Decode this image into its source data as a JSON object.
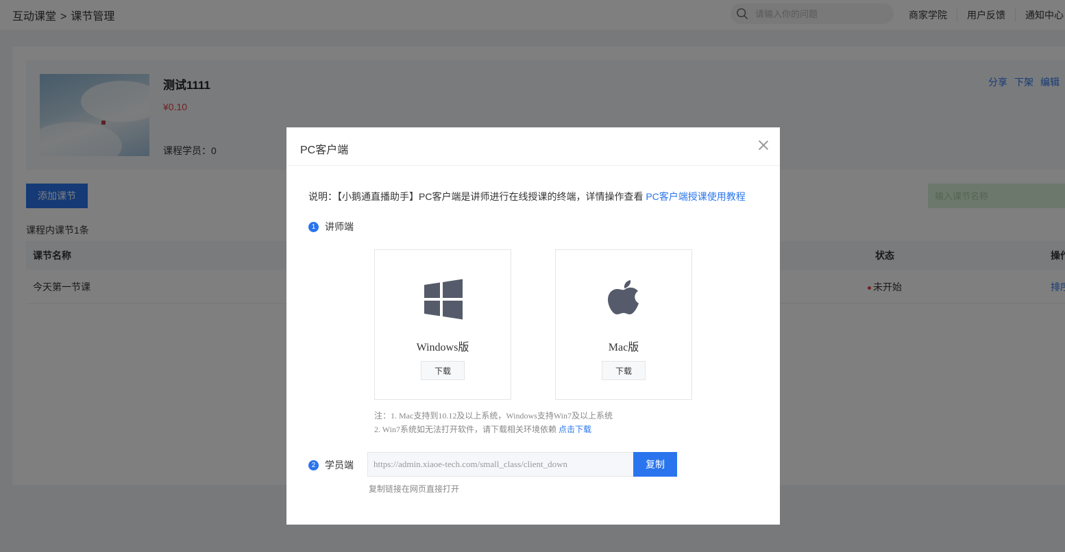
{
  "header": {
    "breadcrumb_home": "互动课堂",
    "breadcrumb_sep": ">",
    "breadcrumb_current": "课节管理",
    "search_placeholder": "请输入你的问题",
    "links": [
      "商家学院",
      "用户反馈",
      "通知中心"
    ]
  },
  "course": {
    "title": "测试1111",
    "price": "¥0.10",
    "students": "课程学员：0",
    "actions": [
      "分享",
      "下架",
      "编辑"
    ]
  },
  "lessons": {
    "add_button": "添加课节",
    "search_placeholder": "输入课节名称",
    "count_text": "课程内课节1条",
    "columns": {
      "name": "课节名称",
      "status": "状态",
      "ops": "操作"
    },
    "rows": [
      {
        "name": "今天第一节课",
        "status": "未开始",
        "op": "排序"
      }
    ]
  },
  "modal": {
    "title": "PC客户端",
    "desc_prefix": "说明：【小鹅通直播助手】PC客户端是讲师进行在线授课的终端，详情操作查看",
    "desc_link": "PC客户端授课使用教程",
    "step1_num": "1",
    "step1_label": "讲师端",
    "windows_label": "Windows版",
    "mac_label": "Mac版",
    "download_label": "下载",
    "note_line1": "注：1. Mac支持到10.12及以上系统，Windows支持Win7及以上系统",
    "note_line2": "2. Win7系统如无法打开软件，请下载相关环境依赖",
    "note_link": "点击下载",
    "step2_num": "2",
    "step2_label": "学员端",
    "url": "https://admin.xiaoe-tech.com/small_class/client_down",
    "copy_label": "复制",
    "url_hint": "复制链接在网页直接打开"
  },
  "colors": {
    "accent": "#2a75ed",
    "price": "#e64340",
    "icon": "#555b6a"
  }
}
